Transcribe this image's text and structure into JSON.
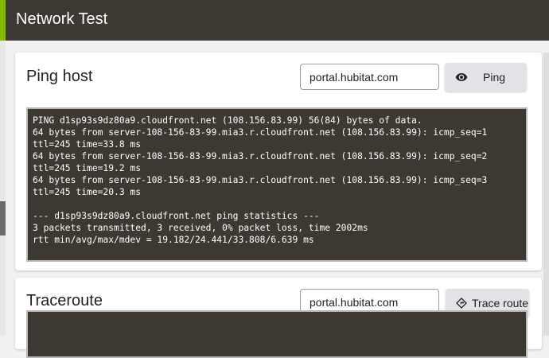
{
  "app": {
    "title": "Network Test"
  },
  "colors": {
    "header_bg": "#3e3832",
    "accent": "#81bc00",
    "terminal_bg": "#3e3832"
  },
  "ping": {
    "title": "Ping host",
    "host_value": "portal.hubitat.com",
    "button_label": "Ping",
    "button_icon": "eye-icon",
    "output": [
      "PING d1sp93s9dz80a9.cloudfront.net (108.156.83.99) 56(84) bytes of data.",
      "64 bytes from server-108-156-83-99.mia3.r.cloudfront.net (108.156.83.99): icmp_seq=1",
      "ttl=245 time=33.8 ms",
      "64 bytes from server-108-156-83-99.mia3.r.cloudfront.net (108.156.83.99): icmp_seq=2",
      "ttl=245 time=19.2 ms",
      "64 bytes from server-108-156-83-99.mia3.r.cloudfront.net (108.156.83.99): icmp_seq=3",
      "ttl=245 time=20.3 ms",
      "",
      "--- d1sp93s9dz80a9.cloudfront.net ping statistics ---",
      "3 packets transmitted, 3 received, 0% packet loss, time 2002ms",
      "rtt min/avg/max/mdev = 19.182/24.441/33.808/6.639 ms"
    ]
  },
  "traceroute": {
    "title": "Traceroute",
    "host_value": "portal.hubitat.com",
    "button_label": "Trace route",
    "button_icon": "route-icon"
  }
}
